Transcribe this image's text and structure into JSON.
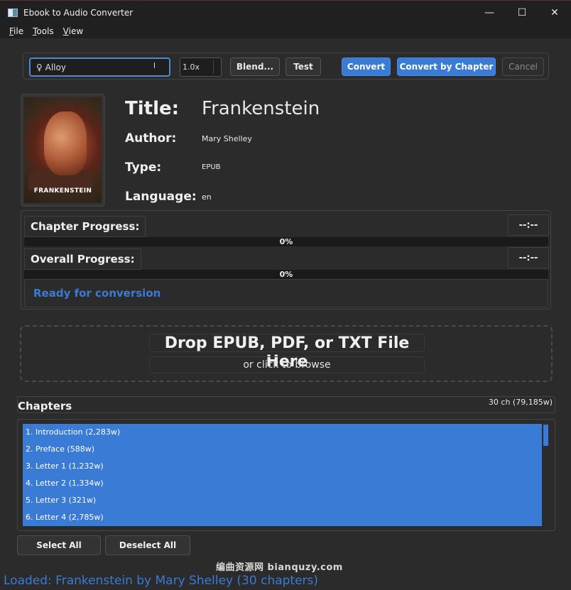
{
  "window": {
    "title": "Ebook to Audio Converter",
    "controls": {
      "minimize": "—",
      "maximize": "☐",
      "close": "✕"
    }
  },
  "menu": [
    {
      "key": "F",
      "rest": "ile"
    },
    {
      "key": "T",
      "rest": "ools"
    },
    {
      "key": "V",
      "rest": "iew"
    }
  ],
  "toolbar": {
    "voice_value": "♀ Alloy",
    "voice_caret": "ı",
    "speed_value": "1.0x",
    "blend_label": "Blend...",
    "test_label": "Test",
    "convert_label": "Convert",
    "convert_by_chapter_label": "Convert by Chapter",
    "cancel_label": "Cancel"
  },
  "book": {
    "cover_text": "FRANKENSTEIN",
    "title_label": "Title:",
    "title": "Frankenstein",
    "author_label": "Author:",
    "author": "Mary Shelley",
    "type_label": "Type:",
    "type": "EPUB",
    "language_label": "Language:",
    "language": "en"
  },
  "progress": {
    "chapter_label": "Chapter Progress:",
    "chapter_time": "--:--",
    "chapter_pct_text": "0%",
    "chapter_fraction": 0,
    "overall_label": "Overall Progress:",
    "overall_time": "--:--",
    "overall_pct_text": "0%",
    "overall_fraction": 0,
    "status": "Ready for conversion"
  },
  "dropzone": {
    "main": "Drop EPUB, PDF, or TXT File Here",
    "sub": "or click to browse"
  },
  "chapters": {
    "title": "Chapters",
    "count": "30 ch (79,185w)",
    "items": [
      "1. Introduction (2,283w)",
      "2. Preface (588w)",
      "3. Letter 1 (1,232w)",
      "4. Letter 2 (1,334w)",
      "5. Letter 3 (321w)",
      "6. Letter 4 (2,785w)"
    ],
    "select_all": "Select All",
    "deselect_all": "Deselect All"
  },
  "watermark": "编曲资源网  bianquzy.com",
  "statusbar": "Loaded: Frankenstein by Mary Shelley (30 chapters)"
}
